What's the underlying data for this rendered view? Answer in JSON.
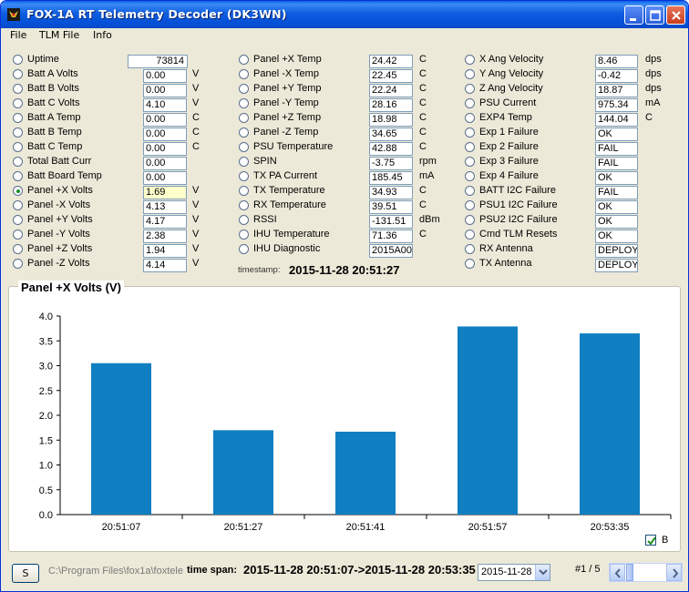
{
  "window": {
    "title": "FOX-1A RT Telemetry Decoder  (DK3WN)"
  },
  "menu": {
    "items": [
      "File",
      "TLM File",
      "Info"
    ]
  },
  "col1": {
    "rows": [
      {
        "label": "Uptime",
        "value": "73814",
        "unit": "",
        "checked": false,
        "align": "right"
      },
      {
        "label": "Batt A Volts",
        "value": "0.00",
        "unit": "V",
        "checked": false
      },
      {
        "label": "Batt B Volts",
        "value": "0.00",
        "unit": "V",
        "checked": false
      },
      {
        "label": "Batt C Volts",
        "value": "4.10",
        "unit": "V",
        "checked": false
      },
      {
        "label": "Batt A Temp",
        "value": "0.00",
        "unit": "C",
        "checked": false
      },
      {
        "label": "Batt B Temp",
        "value": "0.00",
        "unit": "C",
        "checked": false
      },
      {
        "label": "Batt C Temp",
        "value": "0.00",
        "unit": "C",
        "checked": false
      },
      {
        "label": "Total Batt Curr",
        "value": "0.00",
        "unit": "",
        "checked": false
      },
      {
        "label": "Batt Board Temp",
        "value": "0.00",
        "unit": "",
        "checked": false
      },
      {
        "label": "Panel +X Volts",
        "value": "1.69",
        "unit": "V",
        "checked": true
      },
      {
        "label": "Panel -X Volts",
        "value": "4.13",
        "unit": "V",
        "checked": false
      },
      {
        "label": "Panel +Y Volts",
        "value": "4.17",
        "unit": "V",
        "checked": false
      },
      {
        "label": "Panel -Y Volts",
        "value": "2.38",
        "unit": "V",
        "checked": false
      },
      {
        "label": "Panel +Z Volts",
        "value": "1.94",
        "unit": "V",
        "checked": false
      },
      {
        "label": "Panel -Z Volts",
        "value": "4.14",
        "unit": "V",
        "checked": false
      }
    ]
  },
  "col2": {
    "rows": [
      {
        "label": "Panel +X Temp",
        "value": "24.42",
        "unit": "C"
      },
      {
        "label": "Panel -X Temp",
        "value": "22.45",
        "unit": "C"
      },
      {
        "label": "Panel +Y Temp",
        "value": "22.24",
        "unit": "C"
      },
      {
        "label": "Panel -Y Temp",
        "value": "28.16",
        "unit": "C"
      },
      {
        "label": "Panel +Z Temp",
        "value": "18.98",
        "unit": "C"
      },
      {
        "label": "Panel -Z Temp",
        "value": "34.65",
        "unit": "C"
      },
      {
        "label": "PSU Temperature",
        "value": "42.88",
        "unit": "C"
      },
      {
        "label": "SPIN",
        "value": "-3.75",
        "unit": "rpm"
      },
      {
        "label": "TX PA Current",
        "value": "185.45",
        "unit": "mA"
      },
      {
        "label": "TX Temperature",
        "value": "34.93",
        "unit": "C"
      },
      {
        "label": "RX Temperature",
        "value": "39.51",
        "unit": "C"
      },
      {
        "label": "RSSI",
        "value": "-131.51",
        "unit": "dBm"
      },
      {
        "label": "IHU Temperature",
        "value": "71.36",
        "unit": "C"
      },
      {
        "label": "IHU Diagnostic",
        "value": "2015A00",
        "unit": ""
      }
    ],
    "timestamp_label": "timestamp:",
    "timestamp_value": "2015-11-28 20:51:27"
  },
  "col3": {
    "rows": [
      {
        "label": "X Ang Velocity",
        "value": "8.46",
        "unit": "dps"
      },
      {
        "label": "Y Ang Velocity",
        "value": "-0.42",
        "unit": "dps"
      },
      {
        "label": "Z Ang Velocity",
        "value": "18.87",
        "unit": "dps"
      },
      {
        "label": "PSU Current",
        "value": "975.34",
        "unit": "mA"
      },
      {
        "label": "EXP4 Temp",
        "value": "144.04",
        "unit": "C"
      },
      {
        "label": "Exp 1 Failure",
        "value": "OK",
        "unit": ""
      },
      {
        "label": "Exp 2 Failure",
        "value": "FAIL",
        "unit": ""
      },
      {
        "label": "Exp 3 Failure",
        "value": "FAIL",
        "unit": ""
      },
      {
        "label": "Exp 4 Failure",
        "value": "OK",
        "unit": ""
      },
      {
        "label": "BATT I2C Failure",
        "value": "FAIL",
        "unit": ""
      },
      {
        "label": "PSU1 I2C Failure",
        "value": "OK",
        "unit": ""
      },
      {
        "label": "PSU2 I2C Failure",
        "value": "OK",
        "unit": ""
      },
      {
        "label": "Cmd TLM Resets",
        "value": "OK",
        "unit": ""
      },
      {
        "label": "RX Antenna",
        "value": "DEPLOY",
        "unit": ""
      },
      {
        "label": "TX Antenna",
        "value": "DEPLOY",
        "unit": ""
      }
    ]
  },
  "chart_data": {
    "type": "bar",
    "title": "Panel +X Volts (V)",
    "categories": [
      "20:51:07",
      "20:51:27",
      "20:51:41",
      "20:51:57",
      "20:53:35"
    ],
    "values": [
      3.05,
      1.7,
      1.67,
      3.79,
      3.65
    ],
    "ylim": [
      0,
      4.0
    ],
    "yticks": [
      "0.0",
      "0.5",
      "1.0",
      "1.5",
      "2.0",
      "2.5",
      "3.0",
      "3.5",
      "4.0"
    ],
    "bar_color": "#0f7fc2",
    "grid": false
  },
  "chart_checkbox": {
    "label": "B",
    "checked": true
  },
  "status": {
    "s_button": "S",
    "path": "C:\\Program Files\\fox1a\\foxtele",
    "timespan_label": "time span:",
    "timespan_value": "2015-11-28 20:51:07->2015-11-28 20:53:35",
    "date_select": "2015-11-28",
    "page_counter": "#1 / 5"
  }
}
